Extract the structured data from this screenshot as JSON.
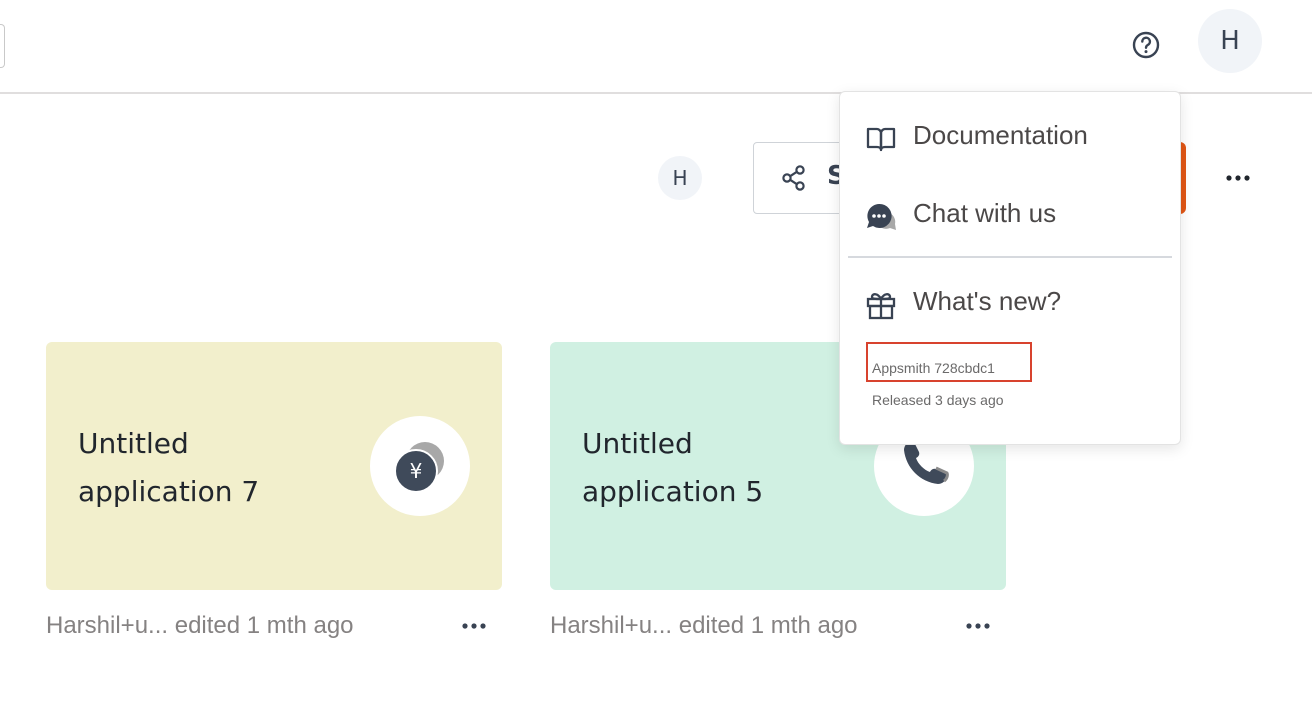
{
  "header": {
    "avatar_initial": "H"
  },
  "toolbar": {
    "member_avatar_initial": "H",
    "share_label": "S"
  },
  "apps": [
    {
      "title": "Untitled application 7",
      "icon": "yen-coins-icon",
      "bg_color": "#f2efcc",
      "meta": "Harshil+u... edited 1 mth ago"
    },
    {
      "title": "Untitled application 5",
      "icon": "phone-icon",
      "bg_color": "#d0f0e2",
      "meta": "Harshil+u... edited 1 mth ago"
    }
  ],
  "help_menu": {
    "items": [
      {
        "label": "Documentation",
        "icon": "book-icon"
      },
      {
        "label": "Chat with us",
        "icon": "chat-icon"
      },
      {
        "label": "What's new?",
        "icon": "gift-icon"
      }
    ],
    "version": "Appsmith 728cbdc1",
    "released": "Released 3 days ago"
  },
  "colors": {
    "primary": "#e15615",
    "highlight": "#d8432e",
    "text": "#4b4848"
  }
}
